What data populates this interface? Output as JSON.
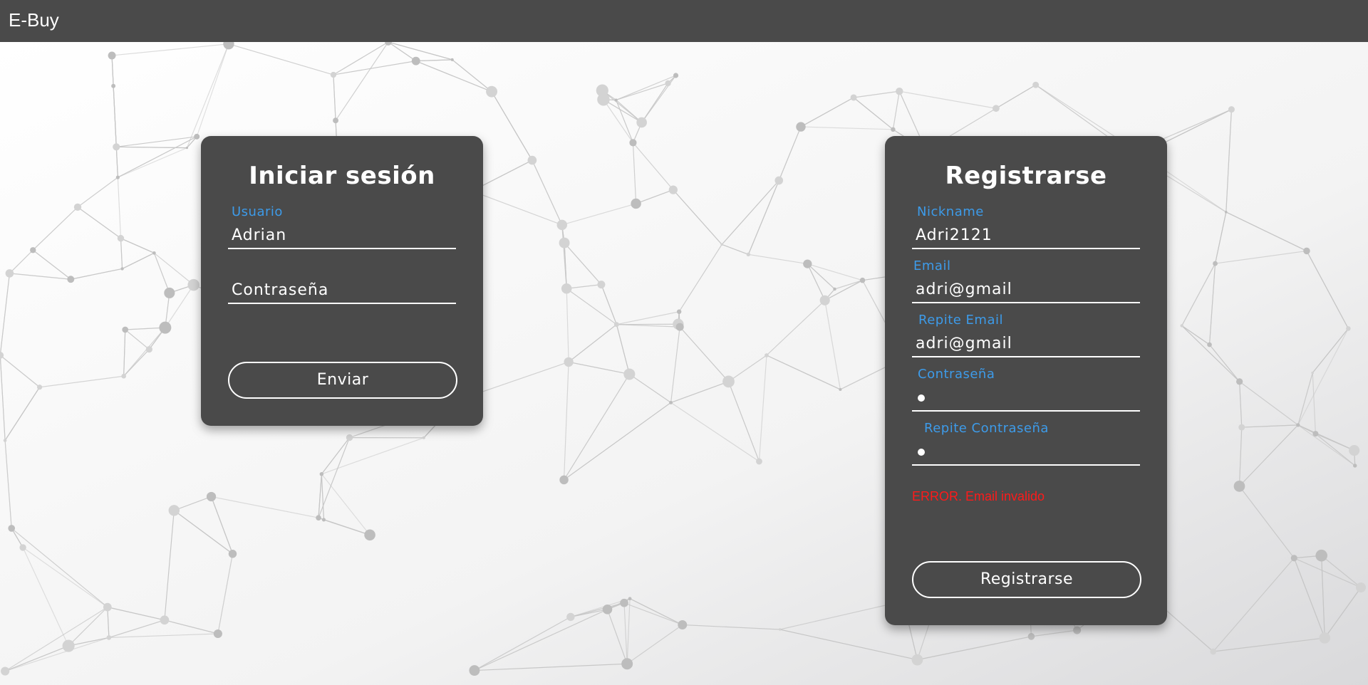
{
  "app": {
    "title": "E-Buy"
  },
  "login": {
    "title": "Iniciar sesión",
    "user_label": "Usuario",
    "user_value": "Adrian",
    "password_placeholder": "Contraseña",
    "submit_label": "Enviar"
  },
  "register": {
    "title": "Registrarse",
    "nickname_label": "Nickname",
    "nickname_value": "Adri2121",
    "email_label": "Email",
    "email_value": "adri@gmail",
    "repeat_email_label": "Repite Email",
    "repeat_email_value": "adri@gmail",
    "password_label": "Contraseña",
    "repeat_password_label": "Repite Contraseña",
    "error_message": "ERROR. Email invalido",
    "submit_label": "Registrarse"
  },
  "colors": {
    "panel": "#4a4a4a",
    "label_accent": "#3d9be9",
    "error": "#ff1a1a"
  }
}
